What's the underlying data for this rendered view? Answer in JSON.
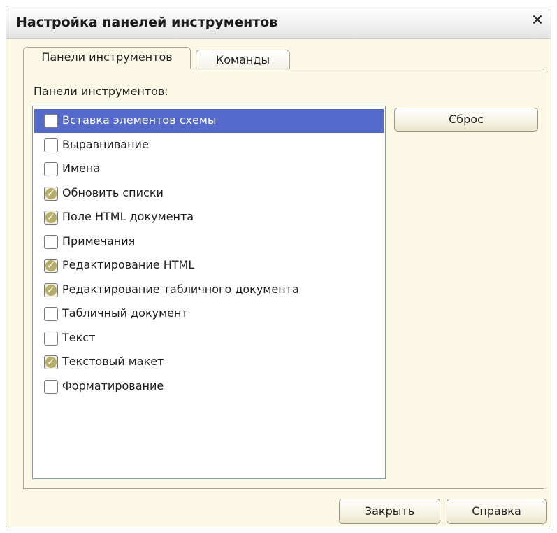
{
  "window": {
    "title": "Настройка панелей инструментов",
    "close_glyph": "✕",
    "close_icon": "close-icon"
  },
  "tabs": [
    {
      "label": "Панели инструментов",
      "active": true
    },
    {
      "label": "Команды",
      "active": false
    }
  ],
  "panel": {
    "label": "Панели инструментов:",
    "items": [
      {
        "label": "Вставка элементов схемы",
        "checked": false,
        "selected": true
      },
      {
        "label": "Выравнивание",
        "checked": false,
        "selected": false
      },
      {
        "label": "Имена",
        "checked": false,
        "selected": false
      },
      {
        "label": "Обновить списки",
        "checked": true,
        "selected": false
      },
      {
        "label": "Поле HTML документа",
        "checked": true,
        "selected": false
      },
      {
        "label": "Примечания",
        "checked": false,
        "selected": false
      },
      {
        "label": "Редактирование HTML",
        "checked": true,
        "selected": false
      },
      {
        "label": "Редактирование табличного документа",
        "checked": true,
        "selected": false
      },
      {
        "label": "Табличный документ",
        "checked": false,
        "selected": false
      },
      {
        "label": "Текст",
        "checked": false,
        "selected": false
      },
      {
        "label": "Текстовый макет",
        "checked": true,
        "selected": false
      },
      {
        "label": "Форматирование",
        "checked": false,
        "selected": false
      }
    ],
    "reset_label": "Сброс"
  },
  "footer": {
    "close_label": "Закрыть",
    "help_label": "Справка"
  },
  "colors": {
    "dialog_background": "#fbf8e5",
    "selection": "#5469c9",
    "checkbox_check": "#b7ad6a"
  }
}
